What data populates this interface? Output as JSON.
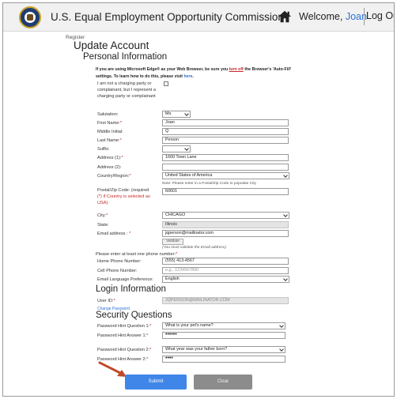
{
  "header": {
    "title": "U.S. Equal Employment Opportunity Commission",
    "welcome_prefix": "Welcome,",
    "user_name": "Joan",
    "logout_label": "Log Out",
    "logo_icon": "eeoc-seal-icon",
    "home_icon": "home-icon"
  },
  "breadcrumb": "Register",
  "page_title": "Update Account",
  "sections": {
    "personal": "Personal Information",
    "login": "Login Information",
    "security": "Security Questions"
  },
  "notice": {
    "part1": "If you are using Microsoft Edge® as your Web Browser, be sure you ",
    "turn_off": "turn off",
    "part2": " the Browser's 'Auto-Fill' settings. To learn how to do this, please visit ",
    "here": "here",
    "part3": "."
  },
  "labels": {
    "not_charging_party": "I am not a charging party or complainant, but I represent a charging party or complainant",
    "salutation": "Salutation:",
    "first_name": "First Name:",
    "middle_initial": "Middle Initial:",
    "last_name": "Last Name:",
    "suffix": "Suffix:",
    "address1": "Address (1):",
    "address2": "Address (2):",
    "country": "Country/Region:",
    "postal": "Postal/Zip Code: (required",
    "postal_2": "(*) if Country is selected as",
    "postal_3": "USA):",
    "city": "City:",
    "state": "State:",
    "email": "Email address : ",
    "phone_note": "Please enter at least one phone number:",
    "home_phone": "Home Phone Number:",
    "cell_phone": "Cell Phone Number:",
    "email_lang": "Email Language Preference:",
    "user_id": "User ID:",
    "q1": "Password Hint Question 1:",
    "a1": "Password Hint Answer 1:",
    "q2": "Password Hint Question 2:",
    "a2": "Password Hint Answer 2:"
  },
  "values": {
    "salutation": "Ms.",
    "first_name": "Joan",
    "middle_initial": "Q",
    "last_name": "Person",
    "suffix": "",
    "address1": "1600 Town Lane",
    "address2": "",
    "country": "United States of America",
    "postal_note": "Note: Please enter in a Postal/Zip Code to populate City",
    "postal": "60601",
    "city": "CHICAGO",
    "state": "Illinois",
    "email": "jqperson@mailinator.com",
    "validate_label": "Validate",
    "validate_note": "(You must validate the Email address)",
    "home_phone": "(555) 413-4567",
    "cell_phone_placeholder": "e.g., 1234567890",
    "email_lang": "English",
    "user_id": "JQPERSON@MAILINATOR.COM",
    "change_password": "Change Password",
    "q1": "What is your pet's name?",
    "a1": "••••••",
    "q2": "What year was your father born?",
    "a2": "••••"
  },
  "buttons": {
    "submit": "Submit",
    "clear": "Clear"
  },
  "colors": {
    "accent": "#3f86e8",
    "required": "#c62828",
    "link": "#2e6fd6",
    "arrow": "#c0492b"
  }
}
